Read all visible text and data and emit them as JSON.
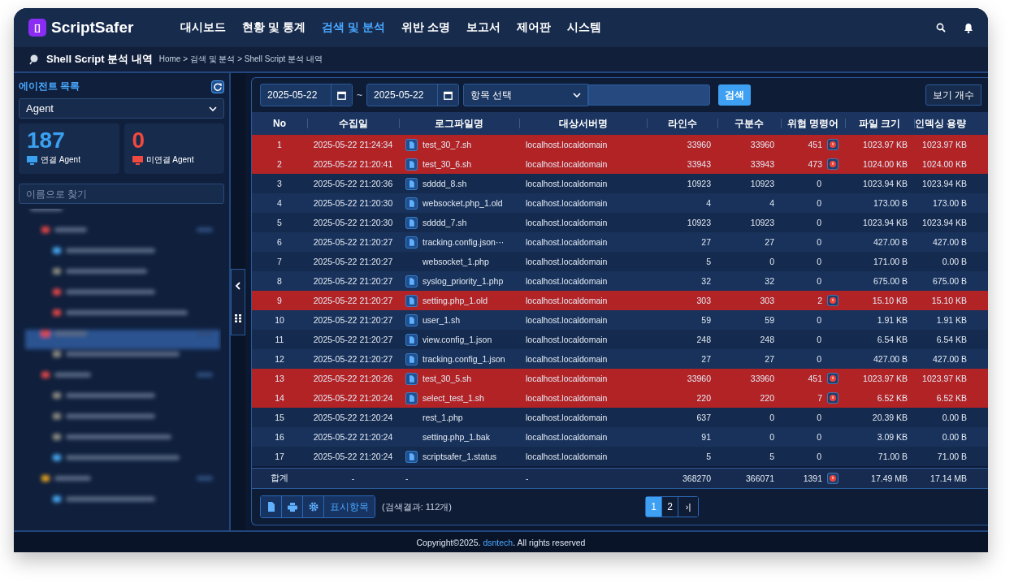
{
  "header": {
    "logo_mark": "[]",
    "logo": "ScriptSafer",
    "nav": [
      {
        "label": "대시보드",
        "selected": false
      },
      {
        "label": "현황 및 통계",
        "selected": false
      },
      {
        "label": "검색 및 분석",
        "selected": true
      },
      {
        "label": "위반 소명",
        "selected": false
      },
      {
        "label": "보고서",
        "selected": false
      },
      {
        "label": "제어판",
        "selected": false
      },
      {
        "label": "시스템",
        "selected": false
      }
    ]
  },
  "breadcrumb": {
    "title": "Shell Script 분석 내역",
    "path": "Home > 검색 및 분석 > Shell Script 분석 내역"
  },
  "sidebar": {
    "title": "에이전트 목록",
    "select": "Agent",
    "stats": [
      {
        "value": "187",
        "label": "연결 Agent",
        "color": "#3aa0f0"
      },
      {
        "value": "0",
        "label": "미연결 Agent",
        "color": "#f0493f"
      }
    ],
    "search": {
      "placeholder": "이름으로 찾기"
    }
  },
  "toolbar": {
    "date_from": "2025-05-22",
    "separator": "~",
    "date_to": "2025-05-22",
    "field_select": "항목 선택",
    "search_button": "검색",
    "view_count": "보기 개수"
  },
  "table": {
    "columns": [
      "No",
      "수집일",
      "로그파일명",
      "대상서버명",
      "라인수",
      "구분수",
      "위협 명령어",
      "파일 크기",
      "인덱싱 용량"
    ],
    "rows": [
      {
        "cells": [
          "1",
          "2025-05-22 21:24:34",
          "test_30_7.sh",
          "localhost.localdomain",
          "33960",
          "33960",
          "451",
          "1023.97 KB",
          "1023.97 KB"
        ],
        "file_icon": true,
        "alert": true
      },
      {
        "cells": [
          "2",
          "2025-05-22 21:20:41",
          "test_30_6.sh",
          "localhost.localdomain",
          "33943",
          "33943",
          "473",
          "1024.00 KB",
          "1024.00 KB"
        ],
        "file_icon": true,
        "alert": true
      },
      {
        "cells": [
          "3",
          "2025-05-22 21:20:36",
          "sdddd_8.sh",
          "localhost.localdomain",
          "10923",
          "10923",
          "0",
          "1023.94 KB",
          "1023.94 KB"
        ],
        "file_icon": true,
        "alert": false
      },
      {
        "cells": [
          "4",
          "2025-05-22 21:20:30",
          "websocket.php_1.old",
          "localhost.localdomain",
          "4",
          "4",
          "0",
          "173.00 B",
          "173.00 B"
        ],
        "file_icon": true,
        "alert": false
      },
      {
        "cells": [
          "5",
          "2025-05-22 21:20:30",
          "sdddd_7.sh",
          "localhost.localdomain",
          "10923",
          "10923",
          "0",
          "1023.94 KB",
          "1023.94 KB"
        ],
        "file_icon": true,
        "alert": false
      },
      {
        "cells": [
          "6",
          "2025-05-22 21:20:27",
          "tracking.config.json···",
          "localhost.localdomain",
          "27",
          "27",
          "0",
          "427.00 B",
          "427.00 B"
        ],
        "file_icon": true,
        "alert": false
      },
      {
        "cells": [
          "7",
          "2025-05-22 21:20:27",
          "websocket_1.php",
          "localhost.localdomain",
          "5",
          "0",
          "0",
          "171.00 B",
          "0.00 B"
        ],
        "file_icon": false,
        "alert": false
      },
      {
        "cells": [
          "8",
          "2025-05-22 21:20:27",
          "syslog_priority_1.php",
          "localhost.localdomain",
          "32",
          "32",
          "0",
          "675.00 B",
          "675.00 B"
        ],
        "file_icon": true,
        "alert": false
      },
      {
        "cells": [
          "9",
          "2025-05-22 21:20:27",
          "setting.php_1.old",
          "localhost.localdomain",
          "303",
          "303",
          "2",
          "15.10 KB",
          "15.10 KB"
        ],
        "file_icon": true,
        "alert": true
      },
      {
        "cells": [
          "10",
          "2025-05-22 21:20:27",
          "user_1.sh",
          "localhost.localdomain",
          "59",
          "59",
          "0",
          "1.91 KB",
          "1.91 KB"
        ],
        "file_icon": true,
        "alert": false
      },
      {
        "cells": [
          "11",
          "2025-05-22 21:20:27",
          "view.config_1.json",
          "localhost.localdomain",
          "248",
          "248",
          "0",
          "6.54 KB",
          "6.54 KB"
        ],
        "file_icon": true,
        "alert": false
      },
      {
        "cells": [
          "12",
          "2025-05-22 21:20:27",
          "tracking.config_1.json",
          "localhost.localdomain",
          "27",
          "27",
          "0",
          "427.00 B",
          "427.00 B"
        ],
        "file_icon": true,
        "alert": false
      },
      {
        "cells": [
          "13",
          "2025-05-22 21:20:26",
          "test_30_5.sh",
          "localhost.localdomain",
          "33960",
          "33960",
          "451",
          "1023.97 KB",
          "1023.97 KB"
        ],
        "file_icon": true,
        "alert": true
      },
      {
        "cells": [
          "14",
          "2025-05-22 21:20:24",
          "select_test_1.sh",
          "localhost.localdomain",
          "220",
          "220",
          "7",
          "6.52 KB",
          "6.52 KB"
        ],
        "file_icon": true,
        "alert": true
      },
      {
        "cells": [
          "15",
          "2025-05-22 21:20:24",
          "rest_1.php",
          "localhost.localdomain",
          "637",
          "0",
          "0",
          "20.39 KB",
          "0.00 B"
        ],
        "file_icon": false,
        "alert": false
      },
      {
        "cells": [
          "16",
          "2025-05-22 21:20:24",
          "setting.php_1.bak",
          "localhost.localdomain",
          "91",
          "0",
          "0",
          "3.09 KB",
          "0.00 B"
        ],
        "file_icon": false,
        "alert": false
      },
      {
        "cells": [
          "17",
          "2025-05-22 21:20:24",
          "scriptsafer_1.status",
          "localhost.localdomain",
          "5",
          "5",
          "0",
          "71.00 B",
          "71.00 B"
        ],
        "file_icon": true,
        "alert": false
      }
    ],
    "total": {
      "cells": [
        "합계",
        "-",
        "-",
        "-",
        "368270",
        "366071",
        "1391",
        "17.49 MB",
        "17.14 MB"
      ],
      "threat_icon": true
    }
  },
  "footer_bar": {
    "display_button": "표시항목",
    "result": "(검색결과: 112개)",
    "pages": [
      {
        "label": "1",
        "selected": true
      },
      {
        "label": "2",
        "selected": false
      }
    ],
    "last_page": "›|"
  },
  "copyright": {
    "prefix": "Copyright©2025. ",
    "link": "dsntech",
    "suffix": ". All rights reserved"
  }
}
